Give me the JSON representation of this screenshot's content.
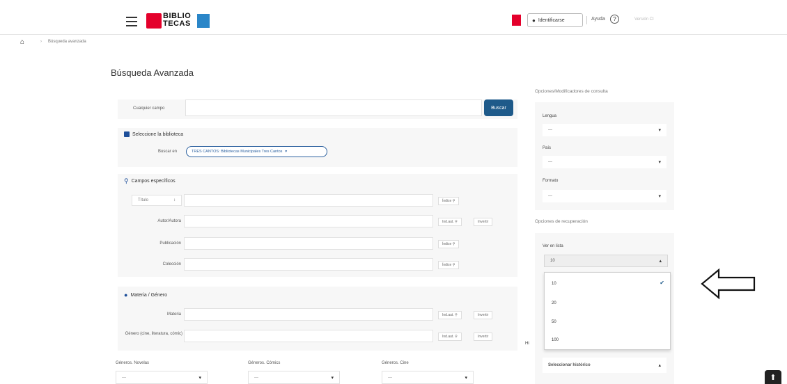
{
  "header": {
    "logo_text_top": "BIBLIO",
    "logo_text_bottom": "TECAS",
    "identify_label": "Identificarse",
    "help_label": "Ayuda",
    "green_label": "Versión CI"
  },
  "breadcrumb": {
    "current": "Búsqueda avanzada"
  },
  "page": {
    "title": "Búsqueda Avanzada"
  },
  "search": {
    "any_field_label": "Cualquier campo",
    "search_button": "Buscar"
  },
  "library": {
    "title": "Seleccione la biblioteca",
    "search_in_label": "Buscar en",
    "selected": "TRES CANTOS: Bibliotecas Municipales Tres Cantos"
  },
  "specific": {
    "title": "Campos específicos",
    "field_select": "Título",
    "index_label": "Índice",
    "rows": [
      {
        "label": "Autor/Autora",
        "buttons": [
          "Ind.aut.",
          "Invertir"
        ]
      },
      {
        "label": "Publicación",
        "buttons": [
          "Índice"
        ]
      },
      {
        "label": "Colección",
        "buttons": [
          "Índice"
        ]
      }
    ]
  },
  "subject": {
    "title": "Materia / Género",
    "rows": [
      {
        "label": "Materia",
        "buttons": [
          "Ind.aut.",
          "Invertir"
        ]
      },
      {
        "label": "Género (cine, literatura, cómic)",
        "buttons": [
          "Ind.aut.",
          "Invertir"
        ]
      }
    ],
    "genre_selects": [
      {
        "label": "Géneros. Novelas",
        "value": "---"
      },
      {
        "label": "Géneros. Cómics",
        "value": "---"
      },
      {
        "label": "Géneros. Cine",
        "value": "---"
      }
    ]
  },
  "query_options": {
    "heading": "Opciones/Modificadores de consulta",
    "fields": [
      {
        "label": "Lengua",
        "value": "---"
      },
      {
        "label": "País",
        "value": "---"
      },
      {
        "label": "Formato",
        "value": "---"
      }
    ]
  },
  "retrieval": {
    "heading": "Opciones de recuperación",
    "per_list_label": "Ver en lista",
    "per_list_value": "10",
    "options": [
      "10",
      "20",
      "50",
      "100"
    ],
    "selected_option": "10",
    "history_partial": "Hi",
    "history_select": "Seleccionar histórico"
  }
}
